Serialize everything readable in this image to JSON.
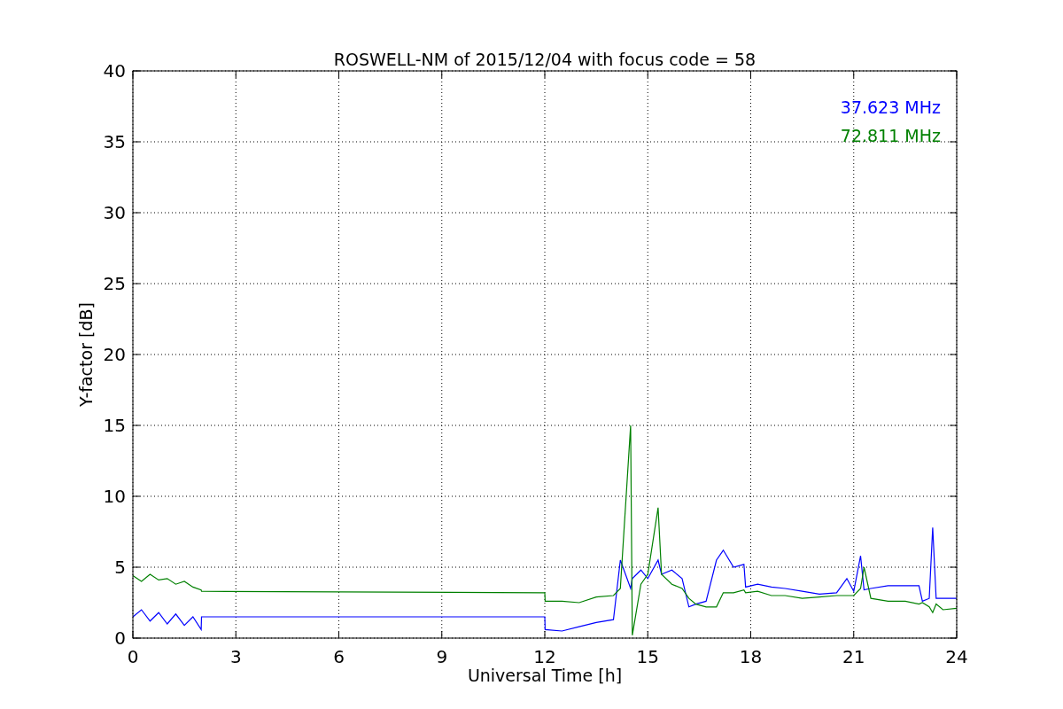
{
  "figure": {
    "chart_data": {
      "type": "line",
      "grid": true,
      "title": "ROSWELL-NM of 2015/12/04 with focus code = 58",
      "xlabel": "Universal Time [h]",
      "ylabel": "Y-factor [dB]",
      "xlim": [
        0,
        24
      ],
      "ylim": [
        0,
        40
      ],
      "xticks": [
        0,
        3,
        6,
        9,
        12,
        15,
        18,
        21,
        24
      ],
      "yticks": [
        0,
        5,
        10,
        15,
        20,
        25,
        30,
        35,
        40
      ],
      "x": [
        0,
        0.25,
        0.5,
        0.75,
        1,
        1.25,
        1.5,
        1.75,
        1.99,
        2,
        12,
        12.01,
        12.5,
        13,
        13.5,
        14,
        14.2,
        14.5,
        14.55,
        14.8,
        15,
        15.3,
        15.4,
        15.7,
        16,
        16.2,
        16.4,
        16.7,
        17,
        17.2,
        17.5,
        17.8,
        17.85,
        18.2,
        18.6,
        19,
        19.5,
        20,
        20.5,
        20.8,
        21,
        21.2,
        21.3,
        21.5,
        22,
        22.5,
        22.9,
        23,
        23.2,
        23.3,
        23.4,
        23.6,
        24
      ],
      "series": [
        {
          "name": "37.623 MHz",
          "color": "#0000ff",
          "values": [
            1.5,
            2.0,
            1.2,
            1.8,
            1.0,
            1.7,
            0.9,
            1.5,
            0.6,
            1.5,
            1.5,
            0.6,
            0.5,
            0.8,
            1.1,
            1.3,
            5.5,
            3.5,
            4.2,
            4.8,
            4.2,
            5.5,
            4.5,
            4.8,
            4.2,
            2.2,
            2.4,
            2.6,
            5.5,
            6.2,
            5.0,
            5.2,
            3.6,
            3.8,
            3.6,
            3.5,
            3.3,
            3.1,
            3.2,
            4.2,
            3.3,
            5.8,
            3.4,
            3.5,
            3.7,
            3.7,
            3.7,
            2.6,
            2.8,
            7.8,
            2.8,
            2.8,
            2.8
          ]
        },
        {
          "name": "72.811 MHz",
          "color": "#008000",
          "values": [
            4.4,
            4.0,
            4.5,
            4.1,
            4.2,
            3.8,
            4.0,
            3.6,
            3.4,
            3.3,
            3.2,
            2.6,
            2.6,
            2.5,
            2.9,
            3.0,
            3.5,
            15,
            0.2,
            3.8,
            4.5,
            9.2,
            4.5,
            3.8,
            3.5,
            2.8,
            2.4,
            2.2,
            2.2,
            3.2,
            3.2,
            3.4,
            3.2,
            3.3,
            3.0,
            3.0,
            2.8,
            2.9,
            3.0,
            3.0,
            3.0,
            3.5,
            5.0,
            2.8,
            2.6,
            2.6,
            2.4,
            2.5,
            2.2,
            1.8,
            2.4,
            2.0,
            2.1
          ]
        }
      ]
    }
  }
}
